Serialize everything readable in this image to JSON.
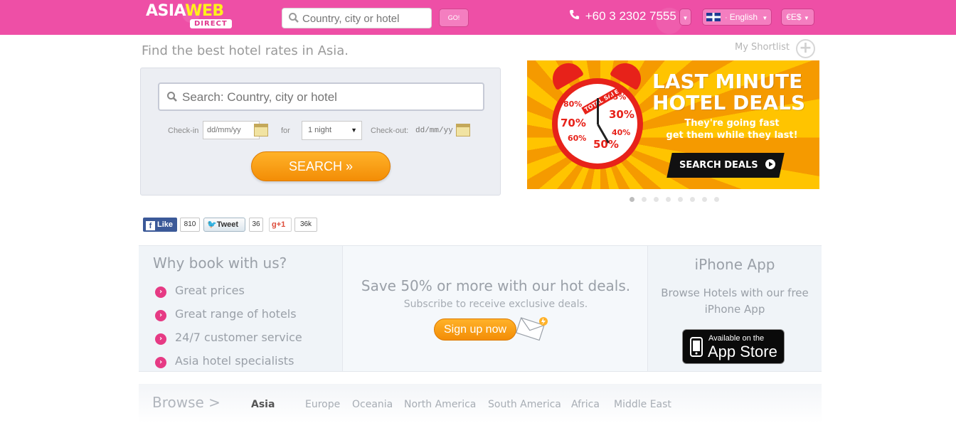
{
  "header": {
    "logo_top_a": "ASIA",
    "logo_top_b": "WEB",
    "logo_bottom": "DIRECT",
    "search_placeholder": "Country, city or hotel",
    "go_label": "GO!",
    "phone": "+60 3 2302 7555",
    "language": "English",
    "currency": "€E$"
  },
  "main": {
    "tagline": "Find the best hotel rates in Asia.",
    "shortlist_label": "My Shortlist"
  },
  "search": {
    "placeholder": "Search: Country, city or hotel",
    "checkin_label": "Check-in",
    "checkin_placeholder": "dd/mm/yy",
    "for_label": "for",
    "nights_value": "1 night",
    "checkout_label": "Check-out:",
    "checkout_value": "dd/mm/yy",
    "button": "SEARCH »"
  },
  "banner": {
    "title_line1": "LAST MINUTE",
    "title_line2": "HOTEL DEALS",
    "sub_line1": "They're going fast",
    "sub_line2": "get them while they last!",
    "button": "SEARCH DEALS",
    "badge": "TOTAL SALE",
    "percents": [
      "15%",
      "30%",
      "40%",
      "50%",
      "60%",
      "70%",
      "80%"
    ],
    "slide_count": 8,
    "active_slide": 1
  },
  "social": {
    "like_label": "Like",
    "like_count": "810",
    "tweet_label": "Tweet",
    "tweet_count": "36",
    "gplus_label": "+1",
    "gplus_count": "36k"
  },
  "why": {
    "heading": "Why book with us?",
    "items": [
      "Great prices",
      "Great range of hotels",
      "24/7 customer service",
      "Asia hotel specialists"
    ]
  },
  "deals": {
    "heading": "Save 50% or more with our hot deals.",
    "sub": "Subscribe to receive exclusive deals.",
    "button": "Sign up now"
  },
  "iphone": {
    "heading": "iPhone App",
    "sub_line1": "Browse Hotels with our free",
    "sub_line2": "iPhone App",
    "badge_line1": "Available on the",
    "badge_line2": "App Store"
  },
  "browse": {
    "heading": "Browse >",
    "regions": [
      "Asia",
      "Europe",
      "Oceania",
      "North America",
      "South America",
      "Africa",
      "Middle East"
    ],
    "active": "Asia"
  },
  "colors": {
    "brand_pink": "#ee4fa6",
    "accent_orange": "#f38d06",
    "bullet_pink": "#e63a84"
  }
}
